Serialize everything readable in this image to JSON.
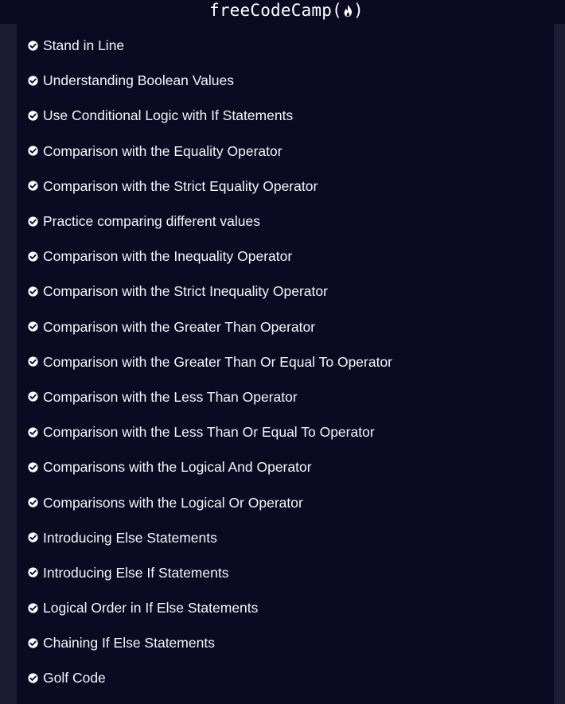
{
  "header": {
    "brand_text": "freeCodeCamp",
    "brand_paren_open": "(",
    "brand_paren_close": ")",
    "brand_icon": "flame-icon"
  },
  "colors": {
    "background": "#1b1b32",
    "panel": "#0a0a23",
    "text": "#f5f6f7",
    "check": "#ffffff"
  },
  "challenges": [
    {
      "label": "Stand in Line",
      "completed": true,
      "icon": "check-circle-icon"
    },
    {
      "label": "Understanding Boolean Values",
      "completed": true,
      "icon": "check-circle-icon"
    },
    {
      "label": "Use Conditional Logic with If Statements",
      "completed": true,
      "icon": "check-circle-icon"
    },
    {
      "label": "Comparison with the Equality Operator",
      "completed": true,
      "icon": "check-circle-icon"
    },
    {
      "label": "Comparison with the Strict Equality Operator",
      "completed": true,
      "icon": "check-circle-icon"
    },
    {
      "label": "Practice comparing different values",
      "completed": true,
      "icon": "check-circle-icon"
    },
    {
      "label": "Comparison with the Inequality Operator",
      "completed": true,
      "icon": "check-circle-icon"
    },
    {
      "label": "Comparison with the Strict Inequality Operator",
      "completed": true,
      "icon": "check-circle-icon"
    },
    {
      "label": "Comparison with the Greater Than Operator",
      "completed": true,
      "icon": "check-circle-icon"
    },
    {
      "label": "Comparison with the Greater Than Or Equal To Operator",
      "completed": true,
      "icon": "check-circle-icon"
    },
    {
      "label": "Comparison with the Less Than Operator",
      "completed": true,
      "icon": "check-circle-icon"
    },
    {
      "label": "Comparison with the Less Than Or Equal To Operator",
      "completed": true,
      "icon": "check-circle-icon"
    },
    {
      "label": "Comparisons with the Logical And Operator",
      "completed": true,
      "icon": "check-circle-icon"
    },
    {
      "label": "Comparisons with the Logical Or Operator",
      "completed": true,
      "icon": "check-circle-icon"
    },
    {
      "label": "Introducing Else Statements",
      "completed": true,
      "icon": "check-circle-icon"
    },
    {
      "label": "Introducing Else If Statements",
      "completed": true,
      "icon": "check-circle-icon"
    },
    {
      "label": "Logical Order in If Else Statements",
      "completed": true,
      "icon": "check-circle-icon"
    },
    {
      "label": "Chaining If Else Statements",
      "completed": true,
      "icon": "check-circle-icon"
    },
    {
      "label": "Golf Code",
      "completed": true,
      "icon": "check-circle-icon"
    }
  ]
}
